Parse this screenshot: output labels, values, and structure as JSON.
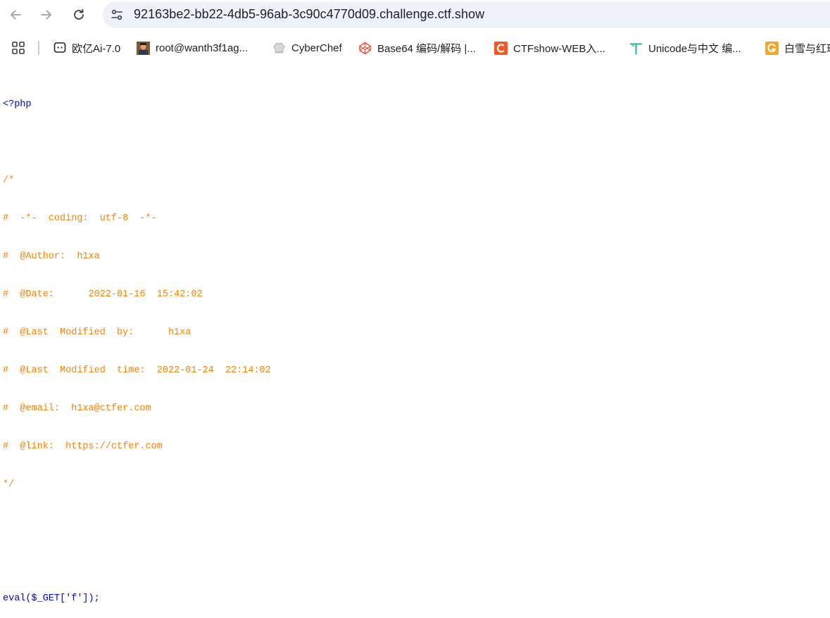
{
  "browser": {
    "url": "92163be2-bb22-4db5-96ab-3c90c4770d09.challenge.ctf.show",
    "icons": {
      "back": "arrow-left-icon",
      "forward": "arrow-right-icon",
      "reload": "reload-icon",
      "site_info": "tune-icon"
    }
  },
  "bookmarks": {
    "apps_icon": "apps-grid-icon",
    "items": [
      {
        "label": "欧亿Ai-7.0",
        "icon": "chat-bubble-icon"
      },
      {
        "label": "root@wanth3f1ag...",
        "icon": "avatar-icon"
      },
      {
        "label": "CyberChef",
        "icon": "chef-hat-icon"
      },
      {
        "label": "Base64 编码/解码 |...",
        "icon": "codepen-cube-icon"
      },
      {
        "label": "CTFshow-WEB入...",
        "icon": "ctfshow-c-icon"
      },
      {
        "label": "Unicode与中文 编...",
        "icon": "t-letter-icon"
      },
      {
        "label": "白雪与红玫",
        "icon": "g-letter-icon"
      }
    ]
  },
  "source": {
    "open_tag": "<?php",
    "comment_lines": [
      "/*",
      "#  -*-  coding:  utf-8  -*-",
      "#  @Author:  h1xa",
      "#  @Date:      2022-01-16  15:42:02",
      "#  @Last  Modified  by:      h1xa",
      "#  @Last  Modified  time:  2022-01-24  22:14:02",
      "#  @email:  h1xa@ctfer.com",
      "#  @link:  https://ctfer.com",
      "*/"
    ],
    "code": "eval($_GET['f']);"
  },
  "colors": {
    "php_default": "#000bbb",
    "php_comment": "#ff8000",
    "omnibox_bg": "#eef1f8"
  }
}
